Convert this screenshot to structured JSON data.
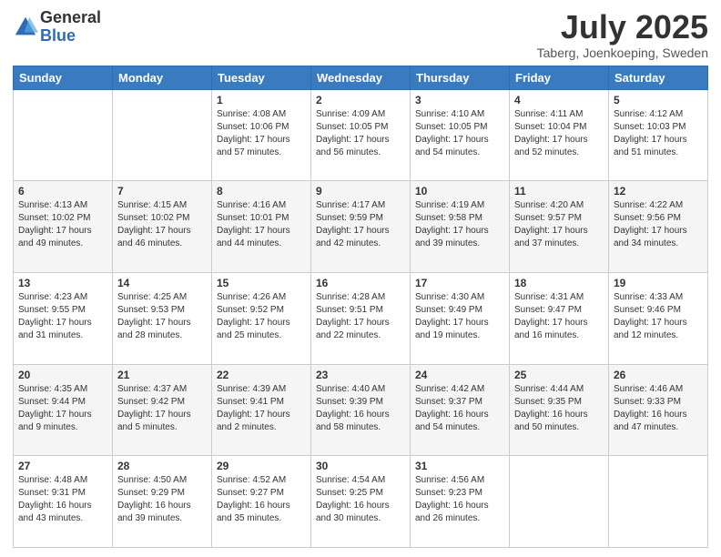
{
  "logo": {
    "general": "General",
    "blue": "Blue"
  },
  "title": "July 2025",
  "location": "Taberg, Joenkoeping, Sweden",
  "days_of_week": [
    "Sunday",
    "Monday",
    "Tuesday",
    "Wednesday",
    "Thursday",
    "Friday",
    "Saturday"
  ],
  "weeks": [
    [
      {
        "day": "",
        "info": ""
      },
      {
        "day": "",
        "info": ""
      },
      {
        "day": "1",
        "info": "Sunrise: 4:08 AM\nSunset: 10:06 PM\nDaylight: 17 hours and 57 minutes."
      },
      {
        "day": "2",
        "info": "Sunrise: 4:09 AM\nSunset: 10:05 PM\nDaylight: 17 hours and 56 minutes."
      },
      {
        "day": "3",
        "info": "Sunrise: 4:10 AM\nSunset: 10:05 PM\nDaylight: 17 hours and 54 minutes."
      },
      {
        "day": "4",
        "info": "Sunrise: 4:11 AM\nSunset: 10:04 PM\nDaylight: 17 hours and 52 minutes."
      },
      {
        "day": "5",
        "info": "Sunrise: 4:12 AM\nSunset: 10:03 PM\nDaylight: 17 hours and 51 minutes."
      }
    ],
    [
      {
        "day": "6",
        "info": "Sunrise: 4:13 AM\nSunset: 10:02 PM\nDaylight: 17 hours and 49 minutes."
      },
      {
        "day": "7",
        "info": "Sunrise: 4:15 AM\nSunset: 10:02 PM\nDaylight: 17 hours and 46 minutes."
      },
      {
        "day": "8",
        "info": "Sunrise: 4:16 AM\nSunset: 10:01 PM\nDaylight: 17 hours and 44 minutes."
      },
      {
        "day": "9",
        "info": "Sunrise: 4:17 AM\nSunset: 9:59 PM\nDaylight: 17 hours and 42 minutes."
      },
      {
        "day": "10",
        "info": "Sunrise: 4:19 AM\nSunset: 9:58 PM\nDaylight: 17 hours and 39 minutes."
      },
      {
        "day": "11",
        "info": "Sunrise: 4:20 AM\nSunset: 9:57 PM\nDaylight: 17 hours and 37 minutes."
      },
      {
        "day": "12",
        "info": "Sunrise: 4:22 AM\nSunset: 9:56 PM\nDaylight: 17 hours and 34 minutes."
      }
    ],
    [
      {
        "day": "13",
        "info": "Sunrise: 4:23 AM\nSunset: 9:55 PM\nDaylight: 17 hours and 31 minutes."
      },
      {
        "day": "14",
        "info": "Sunrise: 4:25 AM\nSunset: 9:53 PM\nDaylight: 17 hours and 28 minutes."
      },
      {
        "day": "15",
        "info": "Sunrise: 4:26 AM\nSunset: 9:52 PM\nDaylight: 17 hours and 25 minutes."
      },
      {
        "day": "16",
        "info": "Sunrise: 4:28 AM\nSunset: 9:51 PM\nDaylight: 17 hours and 22 minutes."
      },
      {
        "day": "17",
        "info": "Sunrise: 4:30 AM\nSunset: 9:49 PM\nDaylight: 17 hours and 19 minutes."
      },
      {
        "day": "18",
        "info": "Sunrise: 4:31 AM\nSunset: 9:47 PM\nDaylight: 17 hours and 16 minutes."
      },
      {
        "day": "19",
        "info": "Sunrise: 4:33 AM\nSunset: 9:46 PM\nDaylight: 17 hours and 12 minutes."
      }
    ],
    [
      {
        "day": "20",
        "info": "Sunrise: 4:35 AM\nSunset: 9:44 PM\nDaylight: 17 hours and 9 minutes."
      },
      {
        "day": "21",
        "info": "Sunrise: 4:37 AM\nSunset: 9:42 PM\nDaylight: 17 hours and 5 minutes."
      },
      {
        "day": "22",
        "info": "Sunrise: 4:39 AM\nSunset: 9:41 PM\nDaylight: 17 hours and 2 minutes."
      },
      {
        "day": "23",
        "info": "Sunrise: 4:40 AM\nSunset: 9:39 PM\nDaylight: 16 hours and 58 minutes."
      },
      {
        "day": "24",
        "info": "Sunrise: 4:42 AM\nSunset: 9:37 PM\nDaylight: 16 hours and 54 minutes."
      },
      {
        "day": "25",
        "info": "Sunrise: 4:44 AM\nSunset: 9:35 PM\nDaylight: 16 hours and 50 minutes."
      },
      {
        "day": "26",
        "info": "Sunrise: 4:46 AM\nSunset: 9:33 PM\nDaylight: 16 hours and 47 minutes."
      }
    ],
    [
      {
        "day": "27",
        "info": "Sunrise: 4:48 AM\nSunset: 9:31 PM\nDaylight: 16 hours and 43 minutes."
      },
      {
        "day": "28",
        "info": "Sunrise: 4:50 AM\nSunset: 9:29 PM\nDaylight: 16 hours and 39 minutes."
      },
      {
        "day": "29",
        "info": "Sunrise: 4:52 AM\nSunset: 9:27 PM\nDaylight: 16 hours and 35 minutes."
      },
      {
        "day": "30",
        "info": "Sunrise: 4:54 AM\nSunset: 9:25 PM\nDaylight: 16 hours and 30 minutes."
      },
      {
        "day": "31",
        "info": "Sunrise: 4:56 AM\nSunset: 9:23 PM\nDaylight: 16 hours and 26 minutes."
      },
      {
        "day": "",
        "info": ""
      },
      {
        "day": "",
        "info": ""
      }
    ]
  ]
}
